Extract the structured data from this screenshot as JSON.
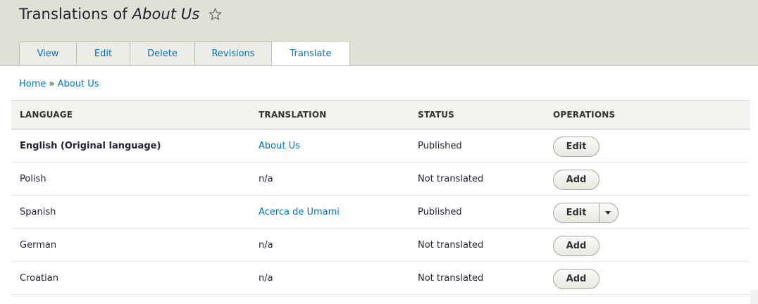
{
  "header": {
    "title_prefix": "Translations of ",
    "title_em": "About Us",
    "star_icon": "star-outline-icon"
  },
  "tabs": [
    {
      "label": "View"
    },
    {
      "label": "Edit"
    },
    {
      "label": "Delete"
    },
    {
      "label": "Revisions"
    },
    {
      "label": "Translate",
      "active": true
    }
  ],
  "breadcrumb": {
    "home": "Home",
    "separator": "»",
    "current": "About Us"
  },
  "table": {
    "headers": [
      "LANGUAGE",
      "TRANSLATION",
      "STATUS",
      "OPERATIONS"
    ],
    "rows": [
      {
        "language": "English (Original language)",
        "translation": "About Us",
        "status": "Published",
        "operation": "Edit"
      },
      {
        "language": "Polish",
        "translation": "n/a",
        "status": "Not translated",
        "operation": "Add"
      },
      {
        "language": "Spanish",
        "translation": "Acerca de Umami",
        "status": "Published",
        "operation": "Edit"
      },
      {
        "language": "German",
        "translation": "n/a",
        "status": "Not translated",
        "operation": "Add"
      },
      {
        "language": "Croatian",
        "translation": "n/a",
        "status": "Not translated",
        "operation": "Add"
      }
    ]
  },
  "colors": {
    "link": "#0074bd",
    "header_bg": "#e0dfd8",
    "table_head_bg": "#f4f3ef"
  }
}
